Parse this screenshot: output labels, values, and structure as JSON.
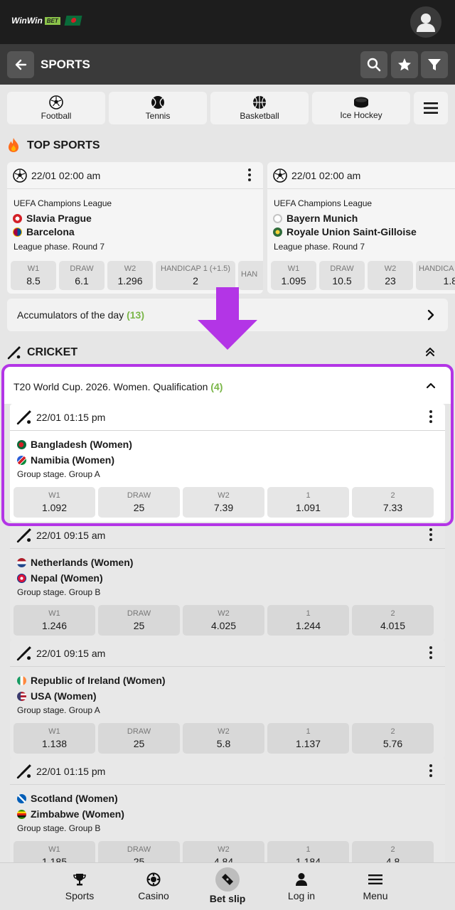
{
  "header": {
    "logo_text": "WinWin",
    "logo_badge": "BET",
    "subbar_title": "SPORTS"
  },
  "sport_tabs": [
    {
      "label": "Football",
      "icon": "football-icon"
    },
    {
      "label": "Tennis",
      "icon": "tennis-icon"
    },
    {
      "label": "Basketball",
      "icon": "basketball-icon"
    },
    {
      "label": "Ice Hockey",
      "icon": "ice-hockey-icon"
    }
  ],
  "top_sports": {
    "title": "TOP SPORTS",
    "cards": [
      {
        "time": "22/01 02:00 am",
        "league": "UEFA Champions League",
        "team1": "Slavia Prague",
        "team2": "Barcelona",
        "stage": "League phase. Round 7",
        "odds": [
          {
            "label": "W1",
            "value": "8.5"
          },
          {
            "label": "DRAW",
            "value": "6.1"
          },
          {
            "label": "W2",
            "value": "1.296"
          },
          {
            "label": "HANDICAP 1 (+1.5)",
            "value": "2"
          },
          {
            "label": "HAN",
            "value": ""
          }
        ]
      },
      {
        "time": "22/01 02:00 am",
        "league": "UEFA Champions League",
        "team1": "Bayern Munich",
        "team2": "Royale Union Saint-Gilloise",
        "stage": "League phase. Round 7",
        "odds": [
          {
            "label": "W1",
            "value": "1.095"
          },
          {
            "label": "DRAW",
            "value": "10.5"
          },
          {
            "label": "W2",
            "value": "23"
          },
          {
            "label": "HANDICA",
            "value": "1.8"
          }
        ]
      }
    ]
  },
  "accumulators": {
    "label": "Accumulators of the day",
    "count": "(13)"
  },
  "cricket": {
    "title": "CRICKET",
    "championship": {
      "label": "T20 World Cup. 2026. Women. Qualification",
      "count": "(4)"
    },
    "matches": [
      {
        "time": "22/01 01:15 pm",
        "team1": "Bangladesh (Women)",
        "team2": "Namibia (Women)",
        "stage": "Group stage. Group A",
        "odds": [
          {
            "label": "W1",
            "value": "1.092"
          },
          {
            "label": "DRAW",
            "value": "25"
          },
          {
            "label": "W2",
            "value": "7.39"
          },
          {
            "label": "1",
            "value": "1.091"
          },
          {
            "label": "2",
            "value": "7.33"
          }
        ]
      },
      {
        "time": "22/01 09:15 am",
        "team1": "Netherlands (Women)",
        "team2": "Nepal (Women)",
        "stage": "Group stage. Group B",
        "odds": [
          {
            "label": "W1",
            "value": "1.246"
          },
          {
            "label": "DRAW",
            "value": "25"
          },
          {
            "label": "W2",
            "value": "4.025"
          },
          {
            "label": "1",
            "value": "1.244"
          },
          {
            "label": "2",
            "value": "4.015"
          }
        ]
      },
      {
        "time": "22/01 09:15 am",
        "team1": "Republic of Ireland (Women)",
        "team2": "USA (Women)",
        "stage": "Group stage. Group A",
        "odds": [
          {
            "label": "W1",
            "value": "1.138"
          },
          {
            "label": "DRAW",
            "value": "25"
          },
          {
            "label": "W2",
            "value": "5.8"
          },
          {
            "label": "1",
            "value": "1.137"
          },
          {
            "label": "2",
            "value": "5.76"
          }
        ]
      },
      {
        "time": "22/01 01:15 pm",
        "team1": "Scotland (Women)",
        "team2": "Zimbabwe (Women)",
        "stage": "Group stage. Group B",
        "odds": [
          {
            "label": "W1",
            "value": "1.185"
          },
          {
            "label": "DRAW",
            "value": "25"
          },
          {
            "label": "W2",
            "value": "4.84"
          },
          {
            "label": "1",
            "value": "1.184"
          },
          {
            "label": "2",
            "value": "4.8"
          }
        ]
      }
    ]
  },
  "bottom_nav": [
    {
      "label": "Sports",
      "icon": "trophy-icon"
    },
    {
      "label": "Casino",
      "icon": "casino-chip-icon"
    },
    {
      "label": "Bet slip",
      "icon": "ticket-icon"
    },
    {
      "label": "Log in",
      "icon": "user-icon"
    },
    {
      "label": "Menu",
      "icon": "hamburger-icon"
    }
  ],
  "colors": {
    "accent_green": "#7ab648",
    "highlight_purple": "#b335e6",
    "topbar": "#1d1d1d",
    "subbar": "#3a3a3a"
  }
}
